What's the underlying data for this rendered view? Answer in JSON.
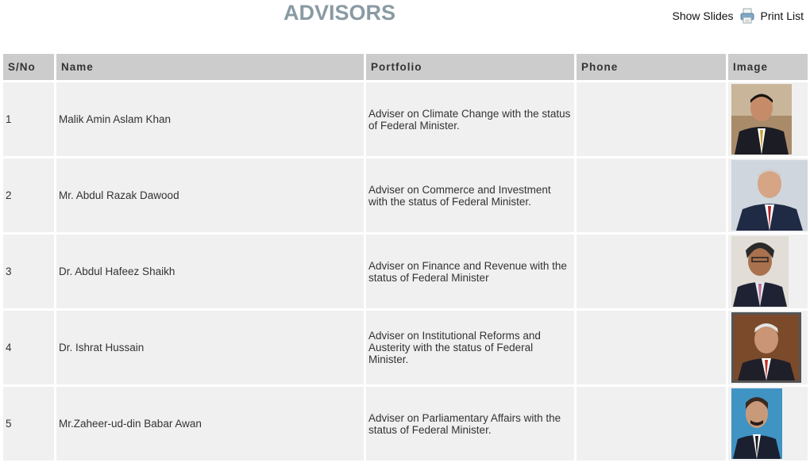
{
  "page": {
    "title": "ADVISORS"
  },
  "actions": {
    "show_slides": "Show Slides",
    "print_list": "Print List"
  },
  "table": {
    "headers": [
      "S/No",
      "Name",
      "Portfolio",
      "Phone",
      "Image"
    ],
    "rows": [
      {
        "sno": "1",
        "name": "Malik Amin Aslam Khan",
        "portfolio": "Adviser on Climate Change with the status of Federal Minister.",
        "phone": ""
      },
      {
        "sno": "2",
        "name": "Mr. Abdul Razak Dawood",
        "portfolio": "Adviser on Commerce and Investment with the status of Federal Minister.",
        "phone": ""
      },
      {
        "sno": "3",
        "name": "Dr. Abdul Hafeez Shaikh",
        "portfolio": "Adviser on Finance and Revenue with the status of Federal Minister",
        "phone": ""
      },
      {
        "sno": "4",
        "name": "Dr. Ishrat Hussain",
        "portfolio": "Adviser on Institutional Reforms and Austerity with the status of Federal Minister.",
        "phone": ""
      },
      {
        "sno": "5",
        "name": "Mr.Zaheer-ud-din Babar Awan",
        "portfolio": "Adviser on Parliamentary Affairs with the status of Federal Minister.",
        "phone": ""
      }
    ]
  },
  "colors": {
    "title": "#8a9aa3",
    "header_bg": "#cccccc",
    "cell_bg": "#f0f0f0"
  },
  "icons": {
    "print": "printer-icon"
  }
}
